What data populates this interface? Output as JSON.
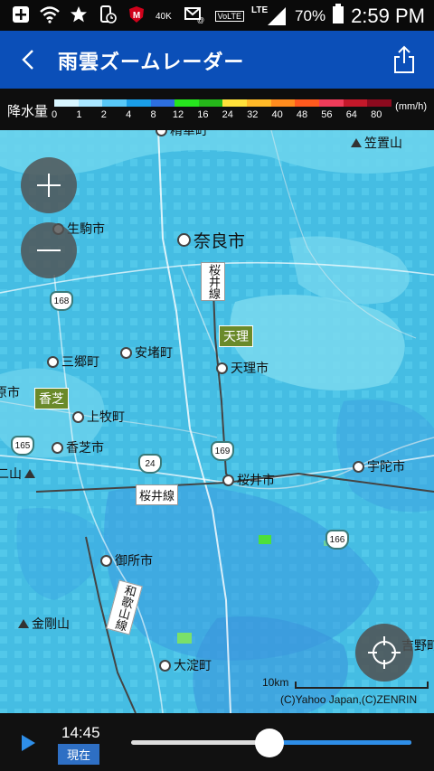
{
  "status_bar": {
    "battery_pct": "70%",
    "time": "2:59 PM",
    "lte": "LTE",
    "volte": "VoLTE",
    "data_speed": "40K"
  },
  "app_bar": {
    "title": "雨雲ズームレーダー"
  },
  "legend": {
    "label": "降水量",
    "unit": "(mm/h)",
    "ticks": [
      "0",
      "1",
      "2",
      "4",
      "8",
      "12",
      "16",
      "24",
      "32",
      "40",
      "48",
      "56",
      "64",
      "80"
    ],
    "colors": [
      "#d8f5ff",
      "#a8e6ff",
      "#58c8f8",
      "#1a9ee8",
      "#2d6fe0",
      "#26e51e",
      "#25b81a",
      "#ffe13a",
      "#ffb928",
      "#ff8c1e",
      "#ff5a1e",
      "#f03c5a",
      "#c4182a",
      "#8c0a1e"
    ]
  },
  "map": {
    "places": {
      "nara": "奈良市",
      "ikoma": "生駒市",
      "yamatokoriyama": "安堵町",
      "sango": "三郷町",
      "kashiba": "香芝市",
      "kanmaki": "上牧町",
      "tenri": "天理市",
      "sakurai": "桜井市",
      "uda": "宇陀市",
      "gose": "御所市",
      "oyodo": "大淀町",
      "kongo": "金剛山",
      "kasagi": "笠置山",
      "top_label": "精華町",
      "left_edge_1": "原市",
      "left_edge_2": "二山",
      "right_edge": "吉野町"
    },
    "stations": {
      "tenri": "天理",
      "kashiba": "香芝"
    },
    "lines": {
      "sakurai_line_h": "桜井線",
      "sakurai_line_v": "桜井線",
      "wakayama_line": "和歌山線"
    },
    "routes": [
      "168",
      "165",
      "24",
      "169",
      "166"
    ],
    "scale_label": "10km",
    "copyright": "(C)Yahoo Japan,(C)ZENRIN"
  },
  "playback": {
    "time": "14:45",
    "now_label": "現在",
    "progress": 0.5
  }
}
